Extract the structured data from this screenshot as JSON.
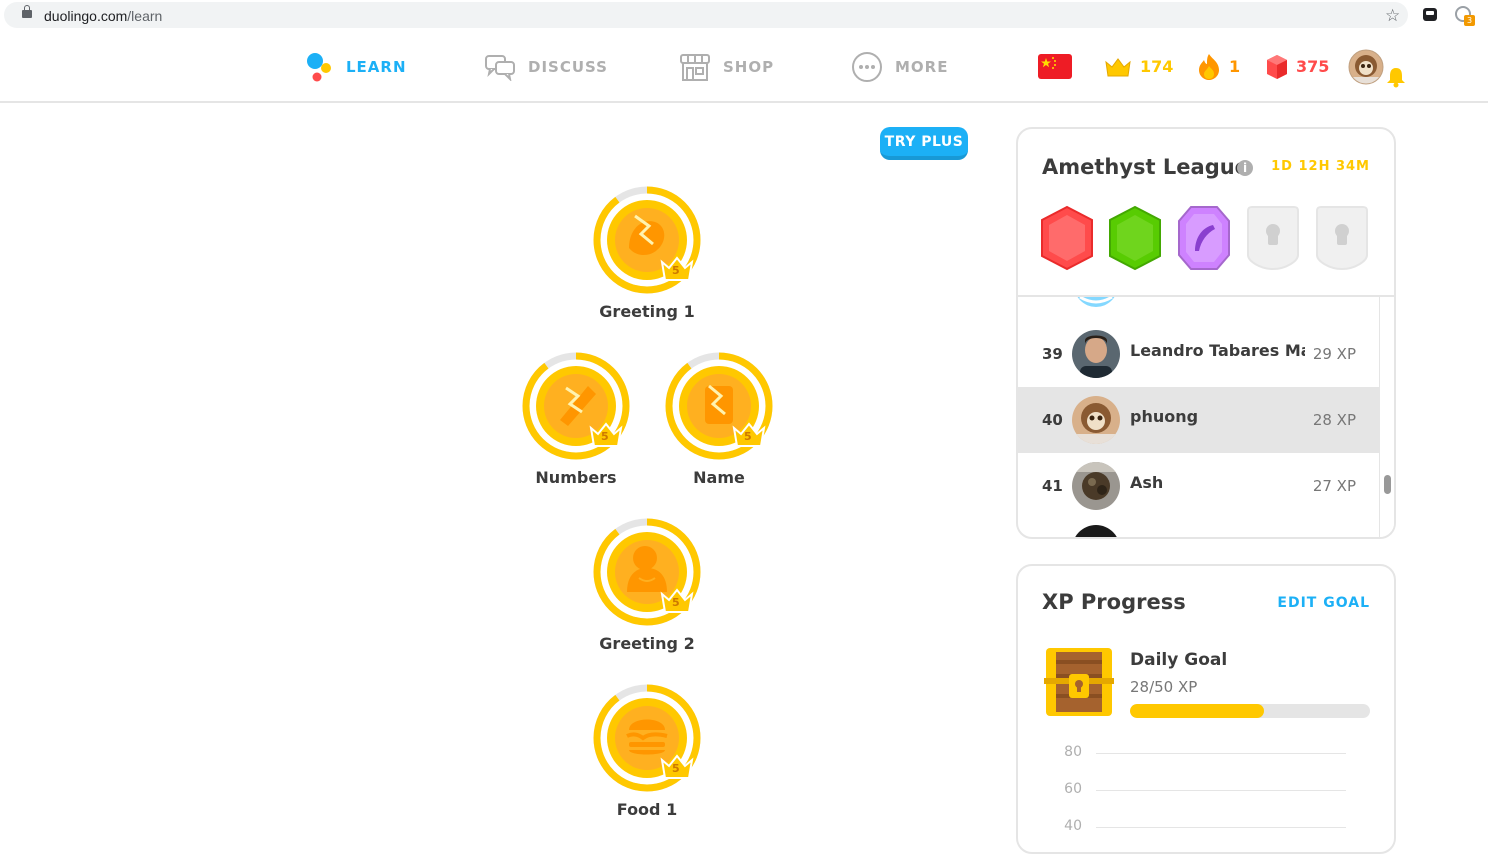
{
  "browser": {
    "url_host": "duolingo.com",
    "url_path": "/learn",
    "extension_badge": "3"
  },
  "nav": {
    "items": [
      {
        "label": "LEARN",
        "active": true
      },
      {
        "label": "DISCUSS",
        "active": false
      },
      {
        "label": "SHOP",
        "active": false
      },
      {
        "label": "MORE",
        "active": false
      }
    ],
    "language_flag": "china-flag-icon",
    "crowns": "174",
    "streak": "1",
    "gems": "375"
  },
  "try_plus": "TRY PLUS",
  "skills": [
    {
      "name": "Greeting 1",
      "level": "5",
      "icon": "greeting-icon"
    },
    {
      "name": "Numbers",
      "level": "5",
      "icon": "numbers-icon"
    },
    {
      "name": "Name",
      "level": "5",
      "icon": "name-icon"
    },
    {
      "name": "Greeting 2",
      "level": "5",
      "icon": "greeting2-icon"
    },
    {
      "name": "Food 1",
      "level": "5",
      "icon": "food-icon"
    }
  ],
  "league": {
    "title": "Amethyst League",
    "info": "i",
    "timer": "1D 12H 34M",
    "badges": [
      "ruby",
      "emerald",
      "amethyst",
      "locked",
      "locked"
    ],
    "rows": [
      {
        "rank": "39",
        "name": "Leandro Tabares Martín",
        "xp": "29 XP",
        "me": false
      },
      {
        "rank": "40",
        "name": "phuong",
        "xp": "28 XP",
        "me": true
      },
      {
        "rank": "41",
        "name": "Ash",
        "xp": "27 XP",
        "me": false
      }
    ]
  },
  "xp_progress": {
    "title": "XP Progress",
    "edit_goal": "EDIT GOAL",
    "daily_goal_label": "Daily Goal",
    "daily_goal_value": "28/50 XP",
    "progress_fraction": 0.56,
    "y_ticks": [
      "80",
      "60",
      "40"
    ]
  },
  "colors": {
    "blue": "#1cb0f6",
    "gold": "#ffc800",
    "orange": "#ff9600",
    "red": "#ff4b4b",
    "text": "#3c3c3c"
  }
}
